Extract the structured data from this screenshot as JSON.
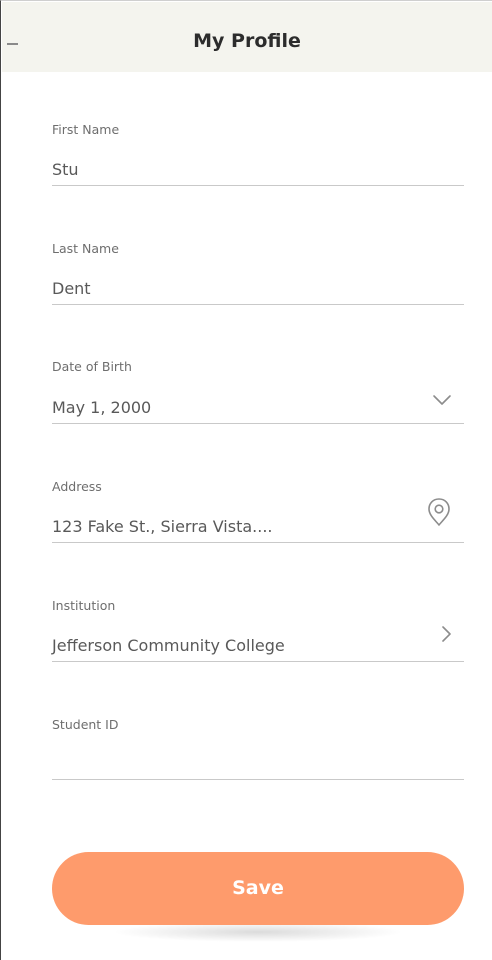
{
  "header": {
    "title": "My Profile",
    "back_icon": "dash-icon"
  },
  "form": {
    "first_name": {
      "label": "First Name",
      "value": "Stu"
    },
    "last_name": {
      "label": "Last Name",
      "value": "Dent"
    },
    "date_of_birth": {
      "label": "Date of Birth",
      "value": "May 1, 2000",
      "icon": "chevron-down-icon"
    },
    "address": {
      "label": "Address",
      "value": "123 Fake St., Sierra Vista....",
      "icon": "location-pin-icon"
    },
    "institution": {
      "label": "Institution",
      "value": "Jefferson Community College",
      "icon": "chevron-right-icon"
    },
    "student_id": {
      "label": "Student ID",
      "value": ""
    }
  },
  "actions": {
    "save_label": "Save"
  },
  "colors": {
    "accent": "#fe9b6c",
    "header_bg": "#f4f4ee",
    "divider": "#c9c9c9"
  }
}
